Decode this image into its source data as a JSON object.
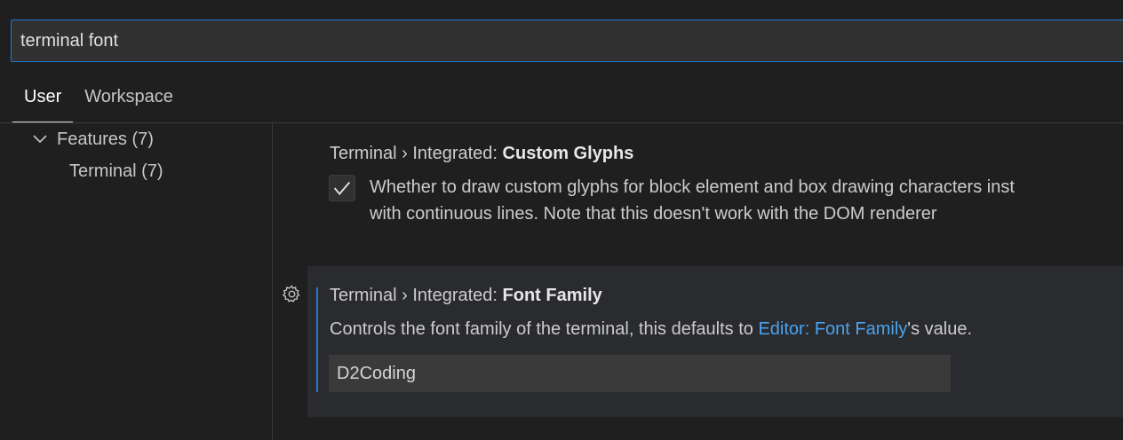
{
  "search": {
    "value": "terminal font"
  },
  "tabs": [
    {
      "label": "User",
      "active": true
    },
    {
      "label": "Workspace",
      "active": false
    }
  ],
  "toc": {
    "group": "Features (7)",
    "child": "Terminal (7)"
  },
  "settings": [
    {
      "category": "Terminal › Integrated: ",
      "name": "Custom Glyphs",
      "checked": true,
      "description_line1": "Whether to draw custom glyphs for block element and box drawing characters inst",
      "description_line2": "with continuous lines. Note that this doesn't work with the DOM renderer"
    },
    {
      "category": "Terminal › Integrated: ",
      "name": "Font Family",
      "description_prefix": "Controls the font family of the terminal, this defaults to ",
      "description_link": "Editor: Font Family",
      "description_suffix": "'s value.",
      "value": "D2Coding"
    }
  ],
  "colors": {
    "accent": "#1f7bd1",
    "link": "#4aa3f0",
    "background": "#1f1f1f"
  },
  "icons": {
    "chevron": "chevron-down-icon",
    "gear": "gear-icon",
    "check": "check-icon"
  }
}
